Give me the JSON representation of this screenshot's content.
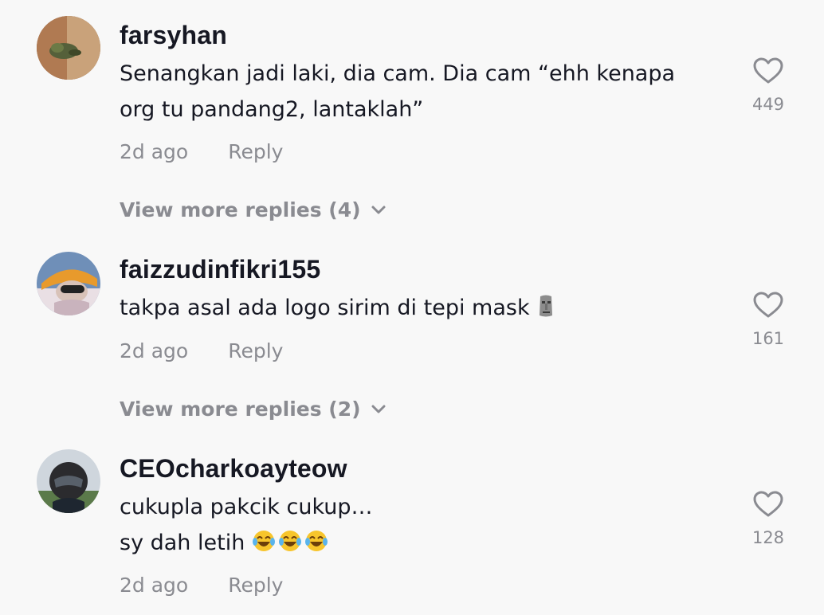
{
  "comments": [
    {
      "username": "farsyhan",
      "text_lines": [
        "Senangkan jadi laki, dia cam. Dia cam “ehh kenapa",
        "org tu pandang2, lantaklah”"
      ],
      "time": "2d ago",
      "reply_label": "Reply",
      "likes": "449",
      "view_more": "View more replies (4)"
    },
    {
      "username": "faizzudinfikri155",
      "text_lines": [
        "takpa asal ada logo sirim di tepi mask"
      ],
      "time": "2d ago",
      "reply_label": "Reply",
      "likes": "161",
      "view_more": "View more replies (2)"
    },
    {
      "username": "CEOcharkoayteow",
      "text_lines": [
        "cukupla pakcik cukup…",
        "sy dah letih"
      ],
      "time": "2d ago",
      "reply_label": "Reply",
      "likes": "128"
    }
  ],
  "colors": {
    "background": "#f8f8f8",
    "primary_text": "#161823",
    "secondary_text": "#8a8b91"
  },
  "icons": {
    "like": "heart-outline-icon",
    "expand": "chevron-down-icon",
    "emoji_moai": "moai-emoji",
    "emoji_laugh": "face-with-tears-of-joy-emoji"
  }
}
